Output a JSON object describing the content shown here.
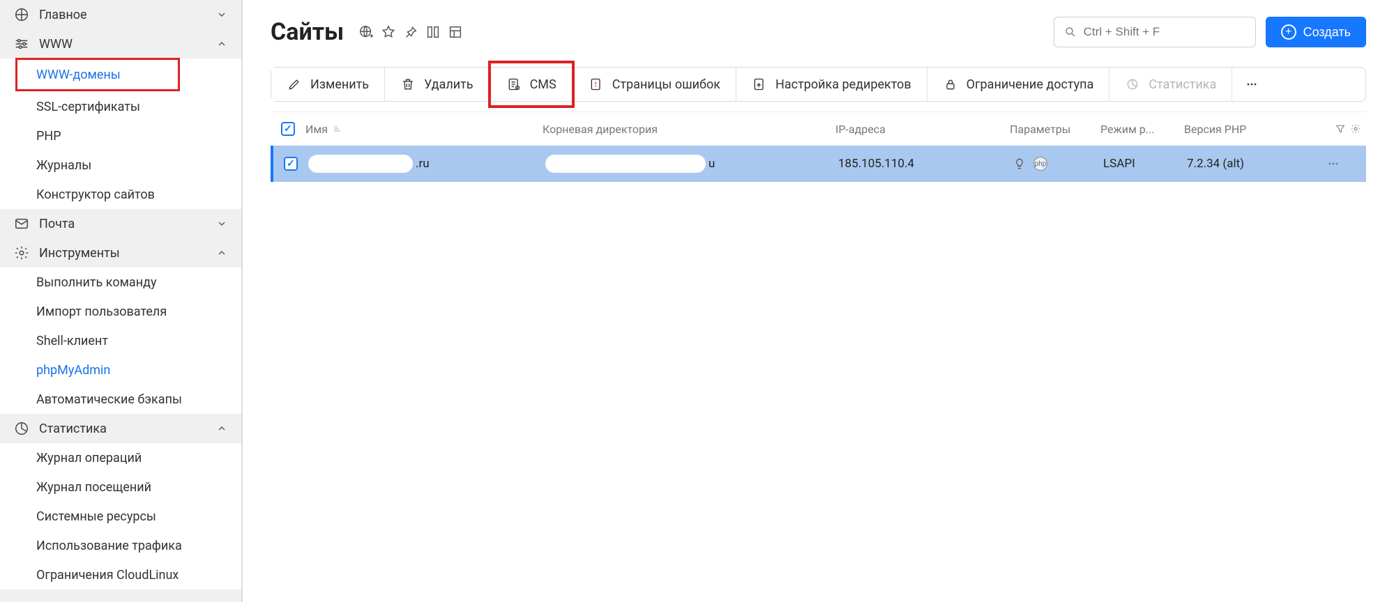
{
  "sidebar": {
    "sections": [
      {
        "key": "main",
        "label": "Главное",
        "expanded": false,
        "items": []
      },
      {
        "key": "www",
        "label": "WWW",
        "expanded": true,
        "items": [
          {
            "key": "www-domains",
            "label": "WWW-домены",
            "active": true,
            "highlight": true
          },
          {
            "key": "ssl",
            "label": "SSL-сертификаты",
            "active": false
          },
          {
            "key": "php",
            "label": "PHP",
            "active": false
          },
          {
            "key": "journals",
            "label": "Журналы",
            "active": false
          },
          {
            "key": "builder",
            "label": "Конструктор сайтов",
            "active": false
          }
        ]
      },
      {
        "key": "mail",
        "label": "Почта",
        "expanded": false,
        "items": []
      },
      {
        "key": "tools",
        "label": "Инструменты",
        "expanded": true,
        "items": [
          {
            "key": "exec",
            "label": "Выполнить команду",
            "active": false
          },
          {
            "key": "import-user",
            "label": "Импорт пользователя",
            "active": false
          },
          {
            "key": "shell",
            "label": "Shell-клиент",
            "active": false
          },
          {
            "key": "pma",
            "label": "phpMyAdmin",
            "active": false,
            "link": true
          },
          {
            "key": "backup",
            "label": "Автоматические бэкапы",
            "active": false
          }
        ]
      },
      {
        "key": "stats",
        "label": "Статистика",
        "expanded": true,
        "items": [
          {
            "key": "oplog",
            "label": "Журнал операций",
            "active": false
          },
          {
            "key": "visitlog",
            "label": "Журнал посещений",
            "active": false
          },
          {
            "key": "sysres",
            "label": "Системные ресурсы",
            "active": false
          },
          {
            "key": "traffic",
            "label": "Использование трафика",
            "active": false
          },
          {
            "key": "cloudlinux",
            "label": "Ограничения CloudLinux",
            "active": false
          }
        ]
      }
    ]
  },
  "page": {
    "title": "Сайты",
    "search_placeholder": "Ctrl + Shift + F",
    "create_label": "Создать"
  },
  "toolbar": {
    "edit": "Изменить",
    "delete": "Удалить",
    "cms": "CMS",
    "errorpages": "Страницы ошибок",
    "redirects": "Настройка редиректов",
    "access": "Ограничение доступа",
    "stats": "Статистика"
  },
  "table": {
    "headers": {
      "name": "Имя",
      "root": "Корневая директория",
      "ip": "IP-адреса",
      "params": "Параметры",
      "mode": "Режим р...",
      "phpver": "Версия PHP"
    },
    "rows": [
      {
        "checked": true,
        "name_suffix": ".ru",
        "root_suffix": "u",
        "ip": "185.105.110.4",
        "mode": "LSAPI",
        "php_version": "7.2.34 (alt)"
      }
    ]
  }
}
